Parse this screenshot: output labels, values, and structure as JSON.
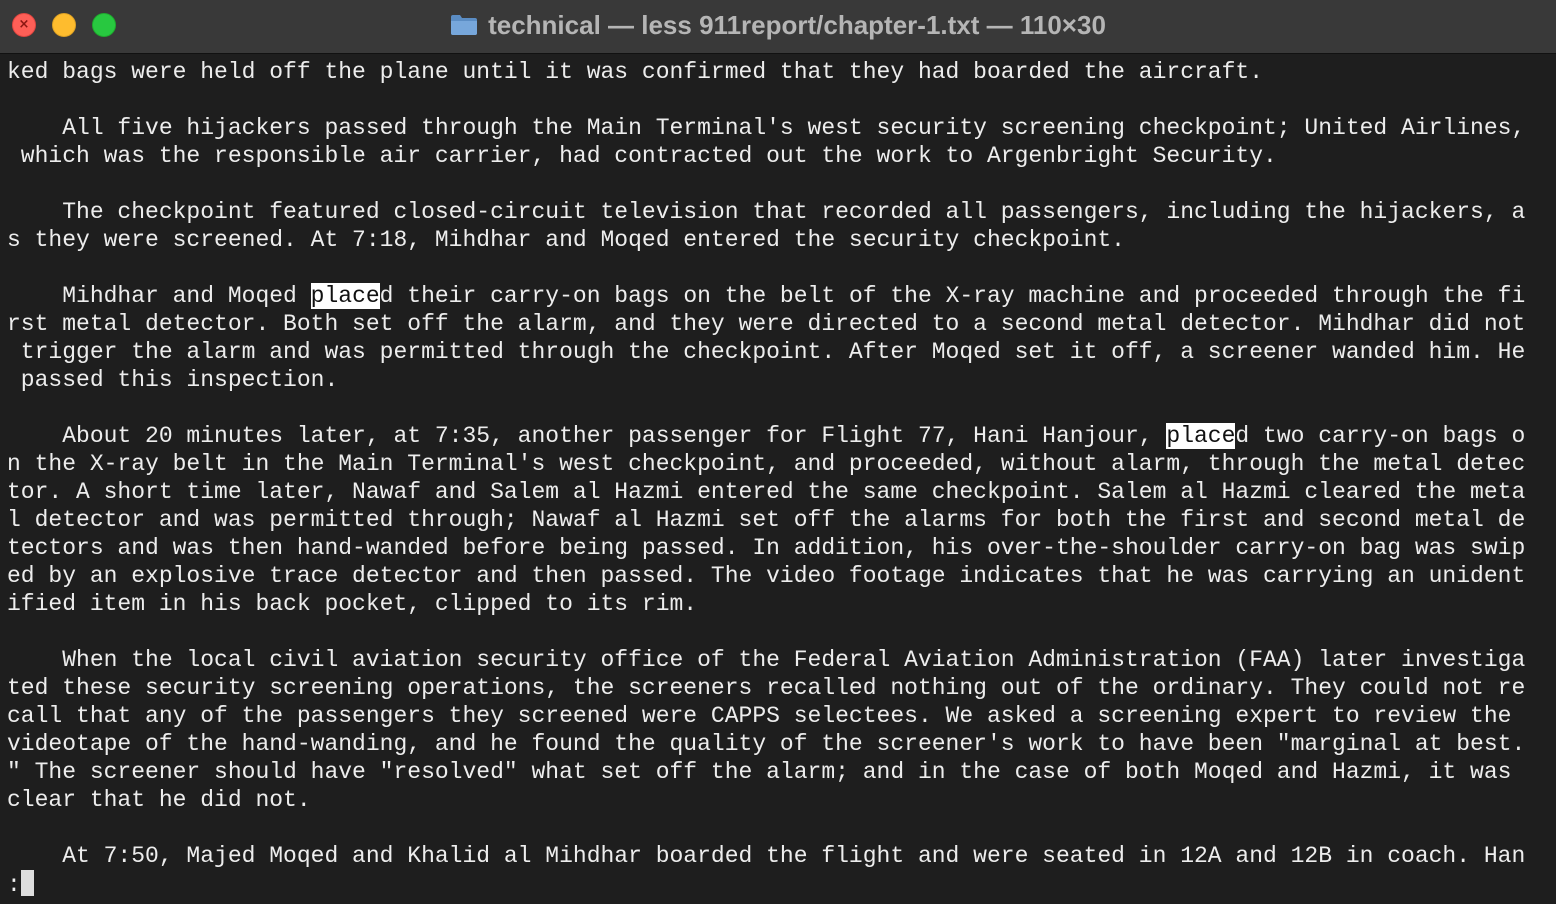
{
  "window": {
    "title": "technical — less 911report/chapter-1.txt — 110×30",
    "folder_icon": "folder-icon",
    "controls": [
      "close-icon",
      "minimize-icon",
      "maximize-icon"
    ],
    "colors": {
      "close": "#fe5f57",
      "minimize": "#febc2e",
      "maximize": "#28c840",
      "background": "#1e1e1e",
      "text": "#ededed",
      "highlight": "#ffffff"
    }
  },
  "terminal": {
    "search_term": "place",
    "lines": [
      "ked bags were held off the plane until it was confirmed that they had boarded the aircraft.",
      "",
      "    All five hijackers passed through the Main Terminal's west security screening checkpoint; United Airlines,",
      " which was the responsible air carrier, had contracted out the work to Argenbright Security.",
      "",
      "    The checkpoint featured closed-circuit television that recorded all passengers, including the hijackers, a",
      "s they were screened. At 7:18, Mihdhar and Moqed entered the security checkpoint.",
      "",
      "    Mihdhar and Moqed placed their carry-on bags on the belt of the X-ray machine and proceeded through the fi",
      "rst metal detector. Both set off the alarm, and they were directed to a second metal detector. Mihdhar did not",
      " trigger the alarm and was permitted through the checkpoint. After Moqed set it off, a screener wanded him. He",
      " passed this inspection.",
      "",
      "    About 20 minutes later, at 7:35, another passenger for Flight 77, Hani Hanjour, placed two carry-on bags o",
      "n the X-ray belt in the Main Terminal's west checkpoint, and proceeded, without alarm, through the metal detec",
      "tor. A short time later, Nawaf and Salem al Hazmi entered the same checkpoint. Salem al Hazmi cleared the meta",
      "l detector and was permitted through; Nawaf al Hazmi set off the alarms for both the first and second metal de",
      "tectors and was then hand-wanded before being passed. In addition, his over-the-shoulder carry-on bag was swip",
      "ed by an explosive trace detector and then passed. The video footage indicates that he was carrying an unident",
      "ified item in his back pocket, clipped to its rim.",
      "",
      "    When the local civil aviation security office of the Federal Aviation Administration (FAA) later investiga",
      "ted these security screening operations, the screeners recalled nothing out of the ordinary. They could not re",
      "call that any of the passengers they screened were CAPPS selectees. We asked a screening expert to review the",
      "videotape of the hand-wanding, and he found the quality of the screener's work to have been \"marginal at best.",
      "\" The screener should have \"resolved\" what set off the alarm; and in the case of both Moqed and Hazmi, it was",
      "clear that he did not.",
      "",
      "    At 7:50, Majed Moqed and Khalid al Mihdhar boarded the flight and were seated in 12A and 12B in coach. Han"
    ],
    "prompt": ":"
  }
}
